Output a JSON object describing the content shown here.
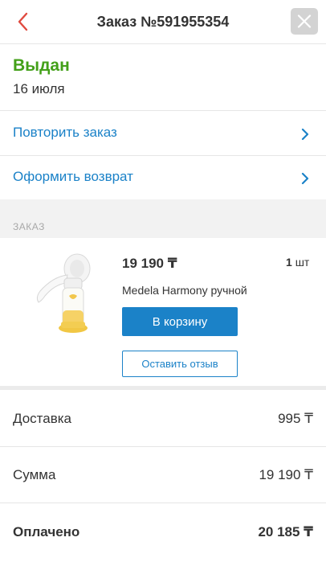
{
  "header": {
    "title": "Заказ №591955354",
    "back_icon": "chevron-left-icon",
    "close_icon": "close-icon",
    "accent": "#e04a3f"
  },
  "status": {
    "label": "Выдан",
    "date": "16 июля",
    "color": "#43a019"
  },
  "actions": {
    "repeat_label": "Повторить заказ",
    "return_label": "Оформить возврат",
    "link_color": "#1b82c8"
  },
  "order": {
    "section_label": "ЗАКАЗ",
    "item": {
      "price": "19 190 ₸",
      "qty_number": "1",
      "qty_unit": "шт",
      "name": "Medela Harmony ручной",
      "cart_button": "В корзину",
      "review_button": "Оставить отзыв",
      "image_icon": "breast-pump-product-image"
    }
  },
  "summary": {
    "delivery_label": "Доставка",
    "delivery_value": "995 ₸",
    "total_label": "Сумма",
    "total_value": "19 190 ₸",
    "paid_label": "Оплачено",
    "paid_value": "20 185 ₸"
  }
}
